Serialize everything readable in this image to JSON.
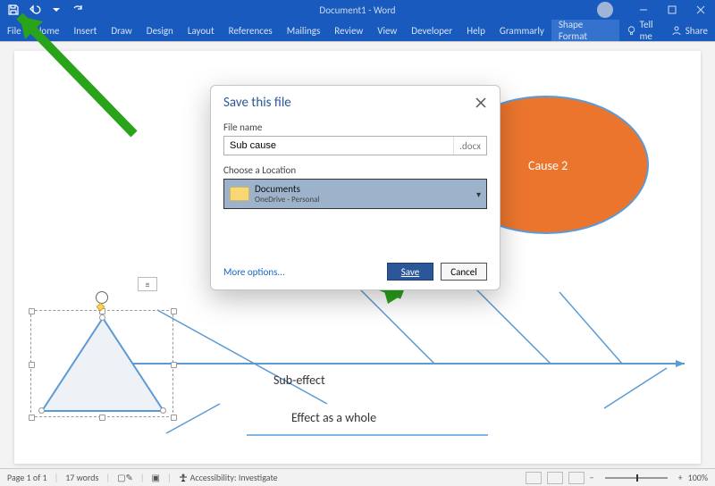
{
  "title": "Document1 - Word",
  "user_name": "",
  "ribbon": {
    "tabs": [
      "File",
      "Home",
      "Insert",
      "Draw",
      "Design",
      "Layout",
      "References",
      "Mailings",
      "Review",
      "View",
      "Developer",
      "Help",
      "Grammarly",
      "Shape Format"
    ],
    "tell_me": "Tell me",
    "share": "Share"
  },
  "canvas": {
    "cause2": "Cause 2",
    "sub_effect": "Sub-effect",
    "effect_whole": "Effect as a whole"
  },
  "dialog": {
    "title": "Save this file",
    "file_name_label": "File name",
    "file_name_value": "Sub cause",
    "file_ext": ".docx",
    "location_label": "Choose a Location",
    "location_name": "Documents",
    "location_sub": "OneDrive - Personal",
    "more": "More options...",
    "save": "Save",
    "cancel": "Cancel"
  },
  "status": {
    "page": "Page 1 of 1",
    "words": "17 words",
    "accessibility": "Accessibility: Investigate",
    "zoom": "100%"
  }
}
